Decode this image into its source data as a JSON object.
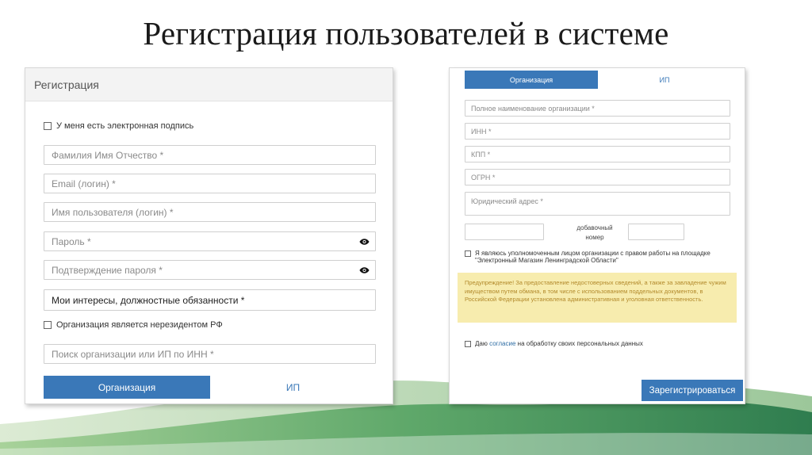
{
  "slide": {
    "title": "Регистрация пользователей в системе"
  },
  "left_form": {
    "header": "Регистрация",
    "signature_checkbox": "У меня есть электронная подпись",
    "full_name_placeholder": "Фамилия Имя Отчество *",
    "email_placeholder": "Email (логин) *",
    "username_placeholder": "Имя пользователя (логин) *",
    "password_placeholder": "Пароль *",
    "password_confirm_placeholder": "Подтверждение пароля *",
    "interests_select": "Мои интересы, должностные обязанности *",
    "nonresident_checkbox": "Организация является нерезидентом РФ",
    "org_search_placeholder": "Поиск организации или ИП по ИНН *",
    "tab_organization": "Организация",
    "tab_ip": "ИП"
  },
  "right_form": {
    "tab_organization": "Организация",
    "tab_ip": "ИП",
    "org_name_placeholder": "Полное наименование организации *",
    "inn_placeholder": "ИНН *",
    "kpp_placeholder": "КПП *",
    "ogrn_placeholder": "ОГРН *",
    "legal_address_placeholder": "Юридический адрес *",
    "extension_label_1": "добавочный",
    "extension_label_2": "номер",
    "authorized_checkbox_line1": "Я являюсь уполномоченным лицом организации с правом работы на площадке",
    "authorized_checkbox_line2": "\"Электронный Магазин Ленинградской Области\"",
    "warning_text": "Предупреждение! За предоставление недостоверных сведений, а также за завладение чужим имуществом путем обмана, в том числе с использованием поддельных документов, в Российской Федерации установлена административная и уголовная ответственность.",
    "consent_prefix": "Даю",
    "consent_link": "согласие",
    "consent_suffix": "на обработку своих персональных данных",
    "submit_button": "Зарегистрироваться"
  },
  "colors": {
    "accent_blue": "#3a78b8",
    "warning_bg": "#f7ecae",
    "warning_text": "#b38a2c",
    "wave_dark_green": "#2f7d4f",
    "wave_light_green": "#8fc08a"
  }
}
